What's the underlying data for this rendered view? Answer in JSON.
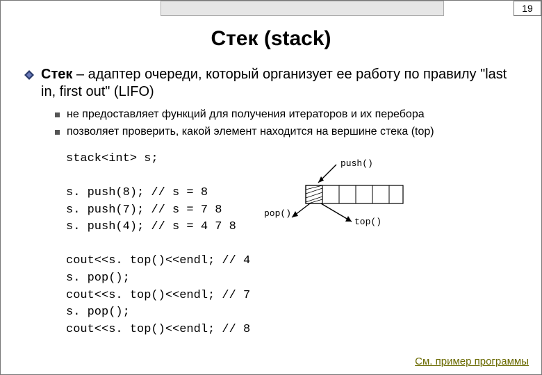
{
  "page_number": "19",
  "title": "Стек (stack)",
  "bullet1_lead": "Стек",
  "bullet1_rest": " – адаптер очереди, который организует ее работу по правилу \"last in, first out\" (LIFO)",
  "sub_bullets": [
    "не предоставляет функций для получения итераторов и их перебора",
    "позволяет проверить, какой элемент находится на вершине стека (top)"
  ],
  "code_lines": [
    "stack<int> s;",
    "",
    "s. push(8); // s = 8",
    "s. push(7); // s = 7 8",
    "s. push(4); // s = 4 7 8",
    "",
    "cout<<s. top()<<endl; // 4",
    "s. pop();",
    "cout<<s. top()<<endl; // 7",
    "s. pop();",
    "cout<<s. top()<<endl; // 8"
  ],
  "diagram": {
    "push": "push()",
    "pop": "pop()",
    "top": "top()"
  },
  "footer_link": "См. пример программы"
}
